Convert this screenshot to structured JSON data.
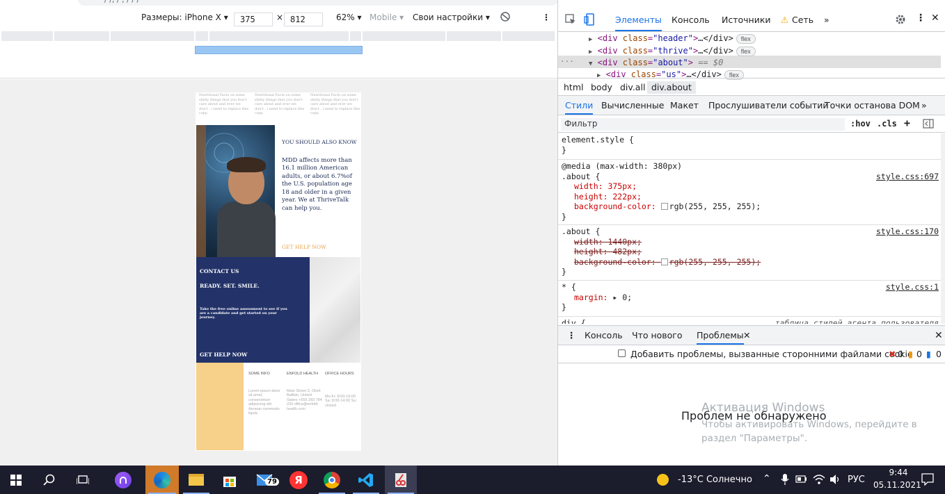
{
  "browser": {
    "url_fragment": "/ /, / , / / /"
  },
  "device_toolbar": {
    "dimensions_label": "Размеры: iPhone X ▾",
    "width": "375",
    "times": "×",
    "height": "812",
    "zoom": "62% ▾",
    "mobile": "Mobile ▾",
    "throttle": "Свои настройки ▾",
    "more": "⋮"
  },
  "page": {
    "nutri_notes": [
      "Nutritional Facts on some shitty things that you don't care about and ever we don't , i need to replace this copy.",
      "Nutritional Facts on some shitty things that you don't care about and ever we don't , i need to replace this copy.",
      "Nutritional Facts on some shitty things that you don't care about and ever we don't , i need to replace this copy."
    ],
    "about": {
      "kicker": "YOU SHOULD ALSO KNOW",
      "body": "MDD affects more than 16.1 million American adults, or about 6.7%of the U.S. population age 18 and older in a given year. We at ThriveTalk can help you.",
      "cta": "GET HELP NOW"
    },
    "contact": {
      "title": "CONTACT US",
      "subtitle": "READY. SET. SMILE.",
      "text": "Take the free online assessment to see if you are a candidate and get started on your journey.",
      "cta": "GET HELP NOW"
    },
    "footer": [
      {
        "heading": "SOME INFO",
        "body": "Lorem ipsum dolor sit amet, consectetuer adipiscing elit. Aenean commodo ligula."
      },
      {
        "heading": "ENFOLD HEALTH",
        "body": "Main Street 3, Okirit Baffalo, United States +555 283 784 233 office@enfold-health.com"
      },
      {
        "heading": "OFFICE HOURS",
        "body": "Mo-Fr: 8:00-19:00 Sa: 8:00-14:00 Su: closed"
      }
    ]
  },
  "devtools": {
    "tabs": [
      "Элементы",
      "Консоль",
      "Источники",
      "Сеть",
      "»"
    ],
    "warn_icon": "⚠",
    "elements": [
      {
        "tag": "div",
        "class": "header",
        "rest": "…</div>",
        "badge": "flex"
      },
      {
        "tag": "div",
        "class": "thrive",
        "rest": "…</div>",
        "badge": "flex"
      },
      {
        "tag": "div",
        "class": "about",
        "rest": " == $0",
        "badge": ""
      },
      {
        "tag": "div",
        "class": "us",
        "rest": "…</div>",
        "badge": "flex"
      }
    ],
    "breadcrumbs": [
      "html",
      "body",
      "div.all",
      "div.about"
    ],
    "style_tabs": [
      "Стили",
      "Вычисленные",
      "Макет",
      "Прослушиватели событий",
      "Точки останова DOM",
      "»"
    ],
    "filter_placeholder": "Фильтр",
    "hov": ":hov",
    "cls": ".cls",
    "plus": "+",
    "rules": {
      "r1_sel": "element.style {",
      "close": "}",
      "r2_media": "@media (max-width: 380px)",
      "r2_sel": ".about {",
      "r2_src": "style.css:697",
      "r2_p1": "width: 375px;",
      "r2_p2": "height: 222px;",
      "r2_p3_name": "background-color:",
      "r2_p3_val": "rgb(255, 255, 255);",
      "r3_sel": ".about {",
      "r3_src": "style.css:170",
      "r3_p1": "width: 1440px;",
      "r3_p2": "height: 482px;",
      "r3_p3_name": "background-color:",
      "r3_p3_val": "rgb(255, 255, 255);",
      "r4_sel": "* {",
      "r4_src": "style.css:1",
      "r4_p1_name": "margin:",
      "r4_p1_val": "▸ 0;",
      "r5_sel": "div {",
      "r5_src": "таблица стилей агента пользователя"
    },
    "drawer_tabs": [
      "Консоль",
      "Что нового",
      "Проблемы"
    ],
    "checkbox_label": "Добавить проблемы, вызванные сторонними файлами cookie",
    "counts": [
      "0",
      "0",
      "0"
    ],
    "no_problems": "Проблем не обнаружено",
    "watermark_title": "Активация Windows",
    "watermark_text": "Чтобы активировать Windows, перейдите в раздел \"Параметры\"."
  },
  "taskbar": {
    "mail_badge": "79",
    "weather": "-13°C  Солнечно",
    "lang": "РУС",
    "time": "9:44",
    "date": "05.11.2021"
  },
  "colors": {
    "accent": "#1a73e8",
    "navy": "#233369",
    "orange": "#e8a44b",
    "taskbar": "#1b1c2c"
  }
}
